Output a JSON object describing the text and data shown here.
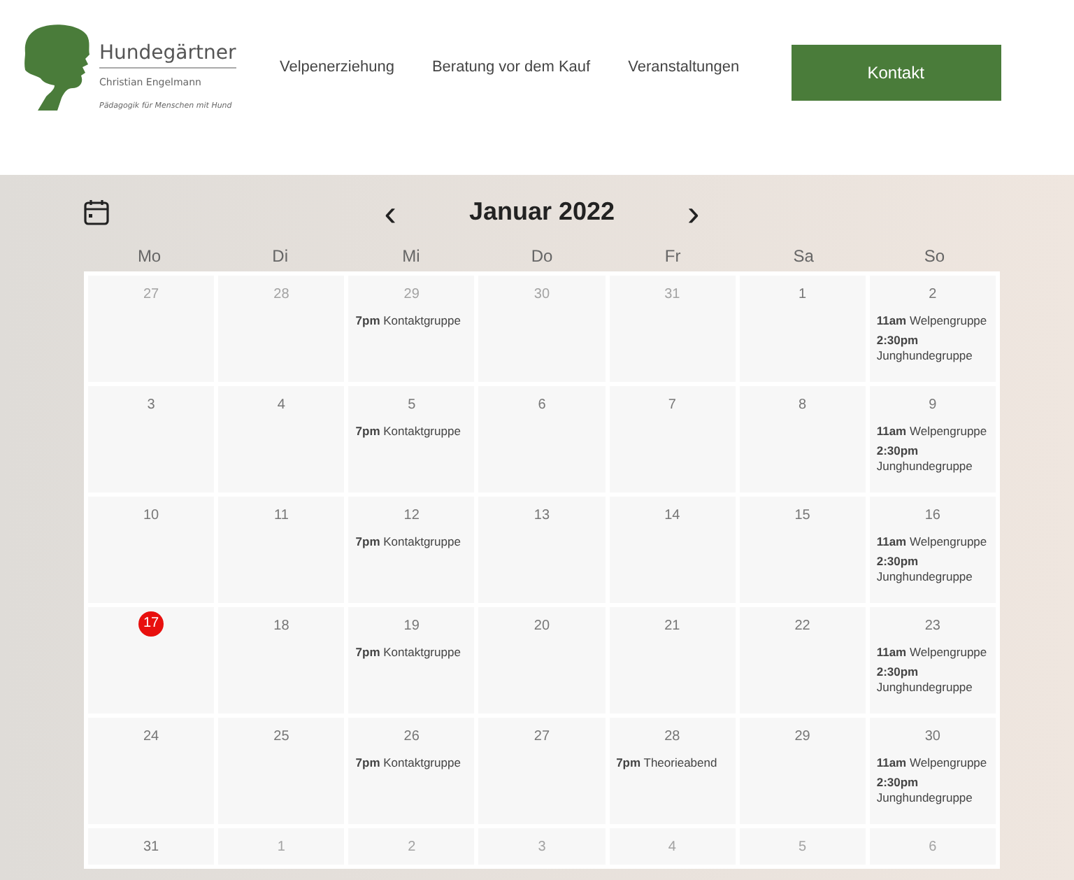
{
  "header": {
    "logo": {
      "title": "Hundegärtner",
      "subtitle": "Christian Engelmann",
      "tagline": "Pädagogik für Menschen mit Hund"
    },
    "nav": [
      {
        "label": "Velpenerziehung"
      },
      {
        "label": "Beratung vor dem Kauf"
      },
      {
        "label": "Veranstaltungen"
      }
    ],
    "cta": "Kontakt"
  },
  "calendar": {
    "month": "Januar 2022",
    "prev": "‹",
    "next": "›",
    "weekdays": [
      "Mo",
      "Di",
      "Mi",
      "Do",
      "Fr",
      "Sa",
      "So"
    ],
    "weeks": [
      [
        {
          "day": "27",
          "muted": true
        },
        {
          "day": "28",
          "muted": true
        },
        {
          "day": "29",
          "muted": true,
          "events": [
            {
              "time": "7pm",
              "title": "Kontaktgruppe"
            }
          ]
        },
        {
          "day": "30",
          "muted": true
        },
        {
          "day": "31",
          "muted": true
        },
        {
          "day": "1",
          "muted": false
        },
        {
          "day": "2",
          "muted": false,
          "events": [
            {
              "time": "11am",
              "title": "Welpengruppe"
            },
            {
              "time": "2:30pm",
              "title": "Junghundegruppe"
            }
          ]
        }
      ],
      [
        {
          "day": "3",
          "muted": false
        },
        {
          "day": "4",
          "muted": false
        },
        {
          "day": "5",
          "muted": false,
          "events": [
            {
              "time": "7pm",
              "title": "Kontaktgruppe"
            }
          ]
        },
        {
          "day": "6",
          "muted": false
        },
        {
          "day": "7",
          "muted": false
        },
        {
          "day": "8",
          "muted": false
        },
        {
          "day": "9",
          "muted": false,
          "events": [
            {
              "time": "11am",
              "title": "Welpengruppe"
            },
            {
              "time": "2:30pm",
              "title": "Junghundegruppe"
            }
          ]
        }
      ],
      [
        {
          "day": "10",
          "muted": false
        },
        {
          "day": "11",
          "muted": false
        },
        {
          "day": "12",
          "muted": false,
          "events": [
            {
              "time": "7pm",
              "title": "Kontaktgruppe"
            }
          ]
        },
        {
          "day": "13",
          "muted": false
        },
        {
          "day": "14",
          "muted": false
        },
        {
          "day": "15",
          "muted": false
        },
        {
          "day": "16",
          "muted": false,
          "events": [
            {
              "time": "11am",
              "title": "Welpengruppe"
            },
            {
              "time": "2:30pm",
              "title": "Junghundegruppe"
            }
          ]
        }
      ],
      [
        {
          "day": "17",
          "muted": false,
          "today": true
        },
        {
          "day": "18",
          "muted": false
        },
        {
          "day": "19",
          "muted": false,
          "events": [
            {
              "time": "7pm",
              "title": "Kontaktgruppe"
            }
          ]
        },
        {
          "day": "20",
          "muted": false
        },
        {
          "day": "21",
          "muted": false
        },
        {
          "day": "22",
          "muted": false
        },
        {
          "day": "23",
          "muted": false,
          "events": [
            {
              "time": "11am",
              "title": "Welpengruppe"
            },
            {
              "time": "2:30pm",
              "title": "Junghundegruppe"
            }
          ]
        }
      ],
      [
        {
          "day": "24",
          "muted": false
        },
        {
          "day": "25",
          "muted": false
        },
        {
          "day": "26",
          "muted": false,
          "events": [
            {
              "time": "7pm",
              "title": "Kontaktgruppe"
            }
          ]
        },
        {
          "day": "27",
          "muted": false
        },
        {
          "day": "28",
          "muted": false,
          "events": [
            {
              "time": "7pm",
              "title": "Theorieabend"
            }
          ]
        },
        {
          "day": "29",
          "muted": false
        },
        {
          "day": "30",
          "muted": false,
          "events": [
            {
              "time": "11am",
              "title": "Welpengruppe"
            },
            {
              "time": "2:30pm",
              "title": "Junghundegruppe"
            }
          ]
        }
      ],
      [
        {
          "day": "31",
          "muted": false
        },
        {
          "day": "1",
          "muted": true
        },
        {
          "day": "2",
          "muted": true
        },
        {
          "day": "3",
          "muted": true
        },
        {
          "day": "4",
          "muted": true
        },
        {
          "day": "5",
          "muted": true
        },
        {
          "day": "6",
          "muted": true
        }
      ]
    ]
  }
}
